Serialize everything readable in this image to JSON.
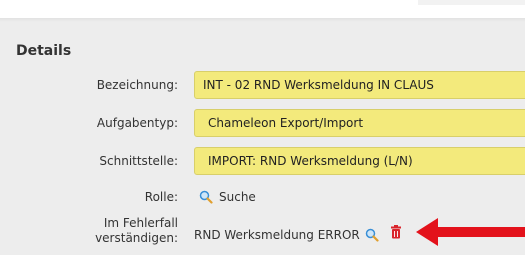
{
  "section": {
    "title": "Details"
  },
  "fields": {
    "bezeichnung": {
      "label": "Bezeichnung:",
      "value": "INT - 02 RND Werksmeldung IN CLAUS"
    },
    "aufgabentyp": {
      "label": "Aufgabentyp:",
      "value": "Chameleon Export/Import"
    },
    "schnittstelle": {
      "label": "Schnittstelle:",
      "value": "IMPORT: RND Werksmeldung (L/N)"
    }
  },
  "rolle": {
    "label": "Rolle:",
    "search_label": "Suche",
    "icon": "search-icon"
  },
  "fehlerfall": {
    "label_line1": "Im Fehlerfall",
    "label_line2": "verständigen:",
    "value": "RND Werksmeldung ERROR",
    "search_icon": "search-icon",
    "delete_icon": "trash-icon"
  },
  "colors": {
    "field_bg": "#f3ea7c",
    "arrow": "#e3121b",
    "delete_icon": "#d9242b",
    "search_icon": "#3a8fd6"
  }
}
